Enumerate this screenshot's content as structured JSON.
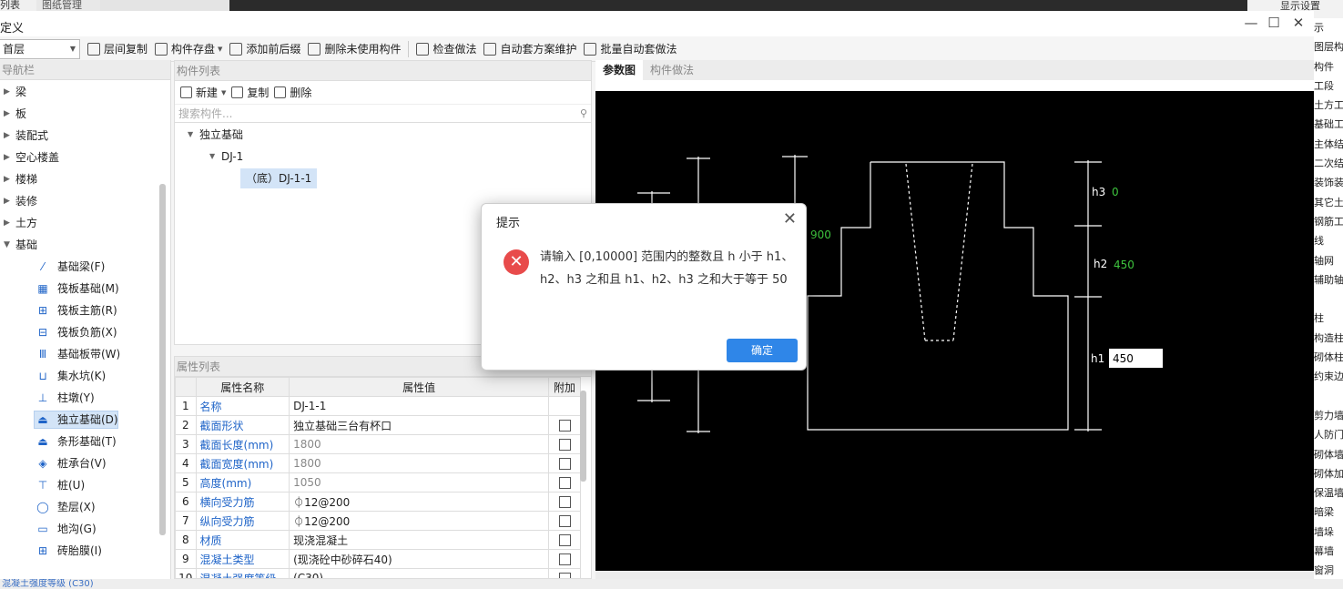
{
  "background": {
    "tab_list": "列表",
    "tab_drawing": "图纸管理",
    "display_settings": "显示设置",
    "right_items": [
      "示",
      "图层构",
      "构件",
      "工段",
      "土方工",
      "基础工",
      "主体结",
      "二次结",
      "装饰装",
      "其它土",
      "钢筋工",
      "线",
      "轴网",
      "辅助轴",
      "",
      "柱",
      "构造柱",
      "砌体柱",
      "约束边",
      "",
      "剪力墙",
      "人防门",
      "砌体墙",
      "砌体加",
      "保温墙",
      "暗梁",
      "墙垛",
      "幕墙",
      "窗洞"
    ],
    "bottom_text": "混凝土强度等级    (C30)"
  },
  "window": {
    "title": "定义",
    "min": "—",
    "max": "☐",
    "close": "✕"
  },
  "toolbar": {
    "floor": "首层",
    "items": [
      "层间复制",
      "构件存盘",
      "添加前后缀",
      "删除未使用构件",
      "检查做法",
      "自动套方案维护",
      "批量自动套做法"
    ]
  },
  "nav": {
    "header": "导航栏",
    "categories": [
      "梁",
      "板",
      "装配式",
      "空心楼盖",
      "楼梯",
      "装修",
      "土方",
      "基础"
    ],
    "subitems": [
      {
        "label": "基础梁(F)",
        "icon": "beam-icon",
        "glyph": "⁄"
      },
      {
        "label": "筏板基础(M)",
        "icon": "raft-icon",
        "glyph": "▦"
      },
      {
        "label": "筏板主筋(R)",
        "icon": "raft-main-bar-icon",
        "glyph": "⊞"
      },
      {
        "label": "筏板负筋(X)",
        "icon": "raft-neg-bar-icon",
        "glyph": "⊟"
      },
      {
        "label": "基础板带(W)",
        "icon": "strip-icon",
        "glyph": "Ⅲ"
      },
      {
        "label": "集水坑(K)",
        "icon": "sump-icon",
        "glyph": "⊔"
      },
      {
        "label": "柱墩(Y)",
        "icon": "pier-icon",
        "glyph": "⊥"
      },
      {
        "label": "独立基础(D)",
        "icon": "isolated-footing-icon",
        "glyph": "⏏"
      },
      {
        "label": "条形基础(T)",
        "icon": "strip-footing-icon",
        "glyph": "⏏"
      },
      {
        "label": "桩承台(V)",
        "icon": "pile-cap-icon",
        "glyph": "◈"
      },
      {
        "label": "桩(U)",
        "icon": "pile-icon",
        "glyph": "⊤"
      },
      {
        "label": "垫层(X)",
        "icon": "cushion-icon",
        "glyph": "◯"
      },
      {
        "label": "地沟(G)",
        "icon": "trench-icon",
        "glyph": "▭"
      },
      {
        "label": "砖胎膜(I)",
        "icon": "brick-mold-icon",
        "glyph": "⊞"
      }
    ]
  },
  "component_list": {
    "header": "构件列表",
    "new_label": "新建",
    "copy_label": "复制",
    "delete_label": "删除",
    "search_placeholder": "搜索构件...",
    "tree_root": "独立基础",
    "tree_child": "DJ-1",
    "tree_leaf": "（底）DJ-1-1"
  },
  "attr_list": {
    "header": "属性列表",
    "col_name": "属性名称",
    "col_value": "属性值",
    "col_extra": "附加",
    "rows": [
      {
        "n": "1",
        "k": "名称",
        "v": "DJ-1-1",
        "gray": false,
        "cb": false
      },
      {
        "n": "2",
        "k": "截面形状",
        "v": "独立基础三台有杯口",
        "gray": false,
        "cb": true
      },
      {
        "n": "3",
        "k": "截面长度(mm)",
        "v": "1800",
        "gray": true,
        "cb": true
      },
      {
        "n": "4",
        "k": "截面宽度(mm)",
        "v": "1800",
        "gray": true,
        "cb": true
      },
      {
        "n": "5",
        "k": "高度(mm)",
        "v": "1050",
        "gray": true,
        "cb": true
      },
      {
        "n": "6",
        "k": "横向受力筋",
        "v": "⏀12@200",
        "gray": false,
        "cb": true
      },
      {
        "n": "7",
        "k": "纵向受力筋",
        "v": "⏀12@200",
        "gray": false,
        "cb": true
      },
      {
        "n": "8",
        "k": "材质",
        "v": "现浇混凝土",
        "gray": false,
        "cb": true
      },
      {
        "n": "9",
        "k": "混凝土类型",
        "v": "(现浇砼中砂碎石40)",
        "gray": false,
        "cb": true
      },
      {
        "n": "10",
        "k": "混凝土强度等级",
        "v": "(C30)",
        "gray": false,
        "cb": true
      }
    ]
  },
  "param_panel": {
    "tab_param": "参数图",
    "tab_method": "构件做法",
    "label_h3": "h3",
    "value_h3": "0",
    "label_h2": "h2",
    "value_h2": "450",
    "label_h1": "h1",
    "value_h1": "450",
    "value_900": "900"
  },
  "dialog": {
    "title": "提示",
    "close": "✕",
    "icon": "✕",
    "message": "请输入 [0,10000] 范围内的整数且 h 小于 h1、h2、h3 之和且 h1、h2、h3 之和大于等于 50",
    "ok_label": "确定"
  }
}
